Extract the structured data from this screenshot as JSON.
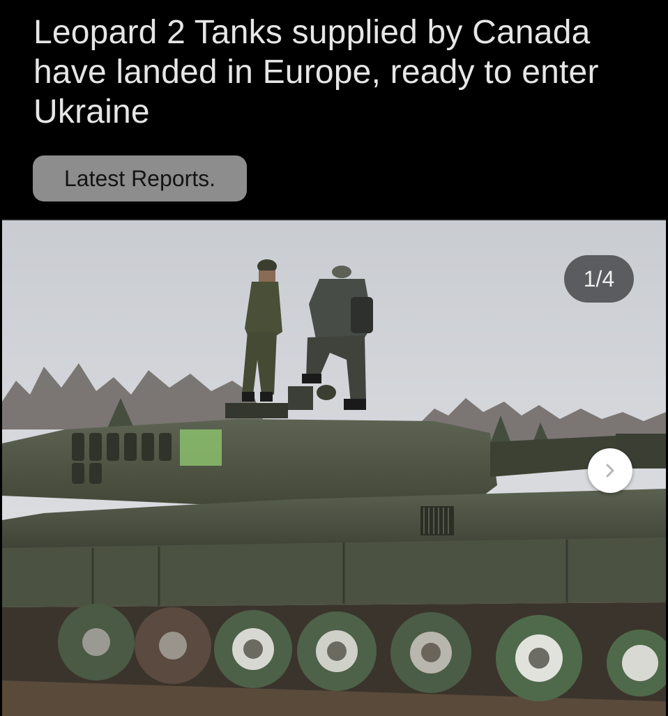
{
  "article": {
    "headline": "Leopard 2 Tanks supplied by Canada have landed in Europe, ready to enter Ukraine",
    "tag_label": "Latest Reports."
  },
  "gallery": {
    "counter": "1/4",
    "next_icon": "chevron-right-icon",
    "image_subject": "tank-photo"
  },
  "colors": {
    "background": "#000000",
    "headline_text": "#e6e6e6",
    "tag_bg": "#8d8d8d",
    "counter_bg": "#46484a",
    "next_button_bg": "#ffffff"
  }
}
